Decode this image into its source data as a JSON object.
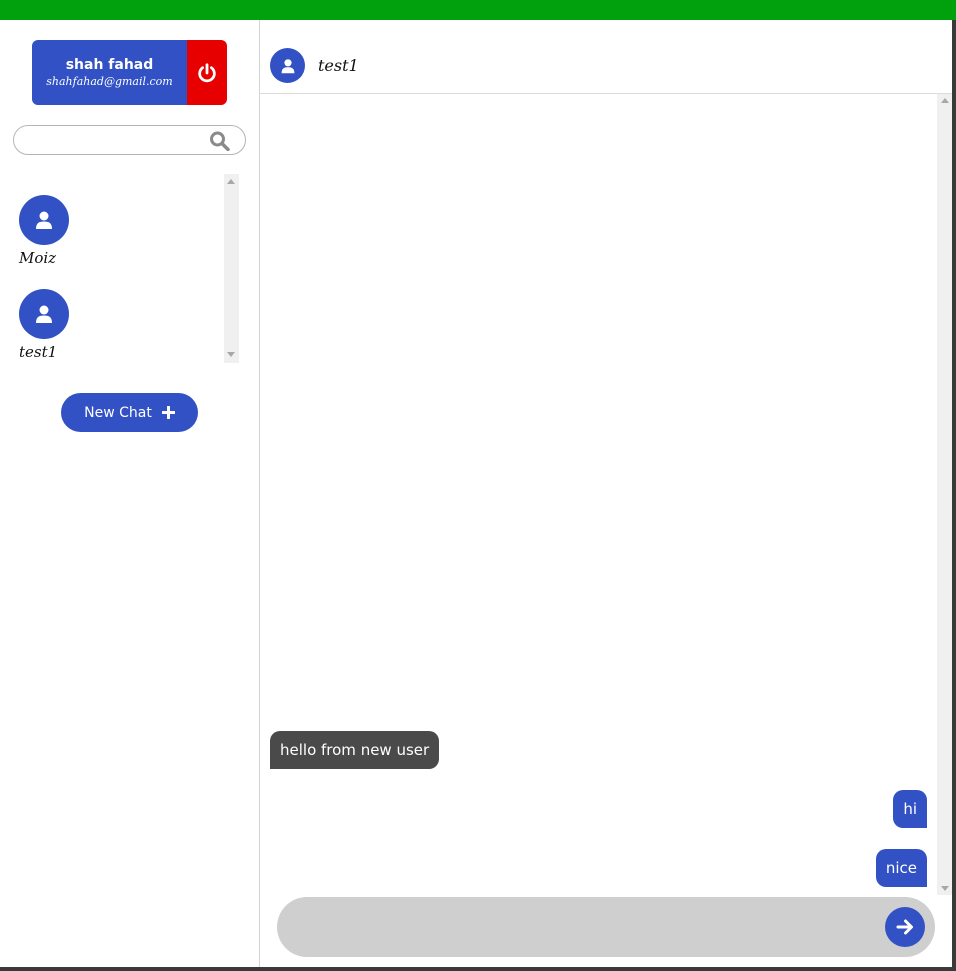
{
  "colors": {
    "topbar": "#00a10c",
    "accent": "#3151c4",
    "logout": "#e60000",
    "incoming_bubble": "#4a4a4a",
    "composer": "#cfcfcf"
  },
  "profile": {
    "name": "shah fahad",
    "email": "shahfahad@gmail.com",
    "logout_icon": "power-icon"
  },
  "search": {
    "value": "",
    "placeholder": "",
    "icon": "search-icon"
  },
  "contacts": [
    {
      "name": "Moiz",
      "icon": "user-icon"
    },
    {
      "name": "test1",
      "icon": "user-icon"
    }
  ],
  "new_chat": {
    "label": "New Chat",
    "icon": "plus-icon"
  },
  "chat": {
    "title": "test1",
    "avatar_icon": "user-icon",
    "messages": [
      {
        "direction": "incoming",
        "text": "hello from new user"
      },
      {
        "direction": "outgoing",
        "text": "hi"
      },
      {
        "direction": "outgoing",
        "text": "nice"
      }
    ]
  },
  "composer": {
    "value": "",
    "placeholder": "",
    "send_icon": "arrow-right-circle-icon"
  }
}
